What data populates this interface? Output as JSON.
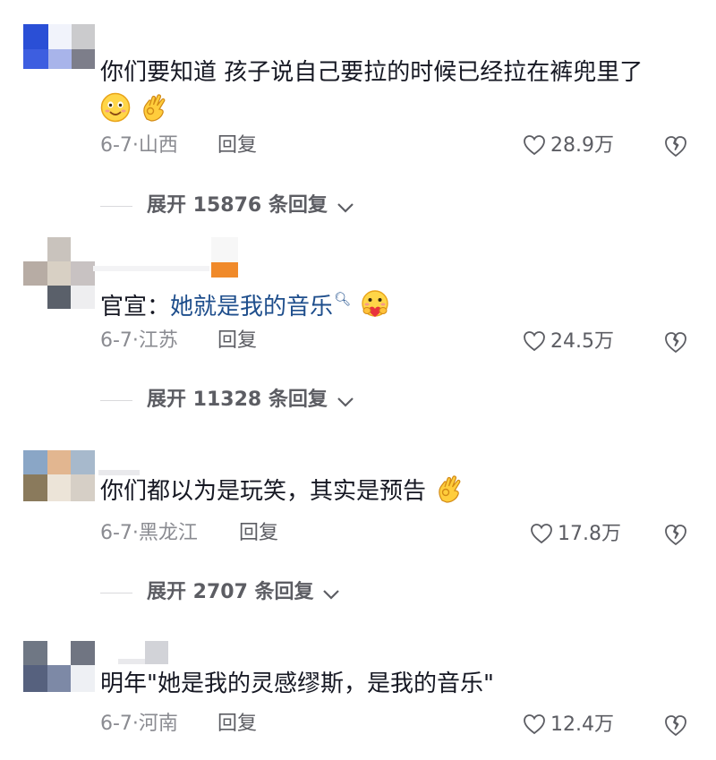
{
  "comments": [
    {
      "text": "你们要知道 孩子说自己要拉的时候已经拉在裤兜里了",
      "emojis": [
        "smile-emoji",
        "ok-hand-emoji"
      ],
      "date_region": "6-7·山西",
      "reply_label": "回复",
      "likes": "28.9万",
      "expand_label": "展开 15876 条回复"
    },
    {
      "prefix": "官宣：",
      "link_text": "她就是我的音乐",
      "emojis": [
        "hug-emoji"
      ],
      "date_region": "6-7·江苏",
      "reply_label": "回复",
      "likes": "24.5万",
      "expand_label": "展开 11328 条回复"
    },
    {
      "text": "你们都以为是玩笑，其实是预告",
      "emojis": [
        "ok-hand-emoji"
      ],
      "date_region": "6-7·黑龙江",
      "reply_label": "回复",
      "likes": "17.8万",
      "expand_label": "展开 2707 条回复"
    },
    {
      "text": "明年\"她是我的灵感缪斯，是我的音乐\"",
      "emojis": [],
      "date_region": "6-7·河南",
      "reply_label": "回复",
      "likes": "12.4万"
    }
  ],
  "colors": {
    "text": "#161823",
    "meta": "#8a8b91",
    "link": "#1e4e8c",
    "icon": "#5c5d63"
  },
  "icons": {
    "like": "heart-outline-icon",
    "dislike": "broken-heart-icon",
    "expand": "chevron-down-icon",
    "mention": "search-icon"
  }
}
